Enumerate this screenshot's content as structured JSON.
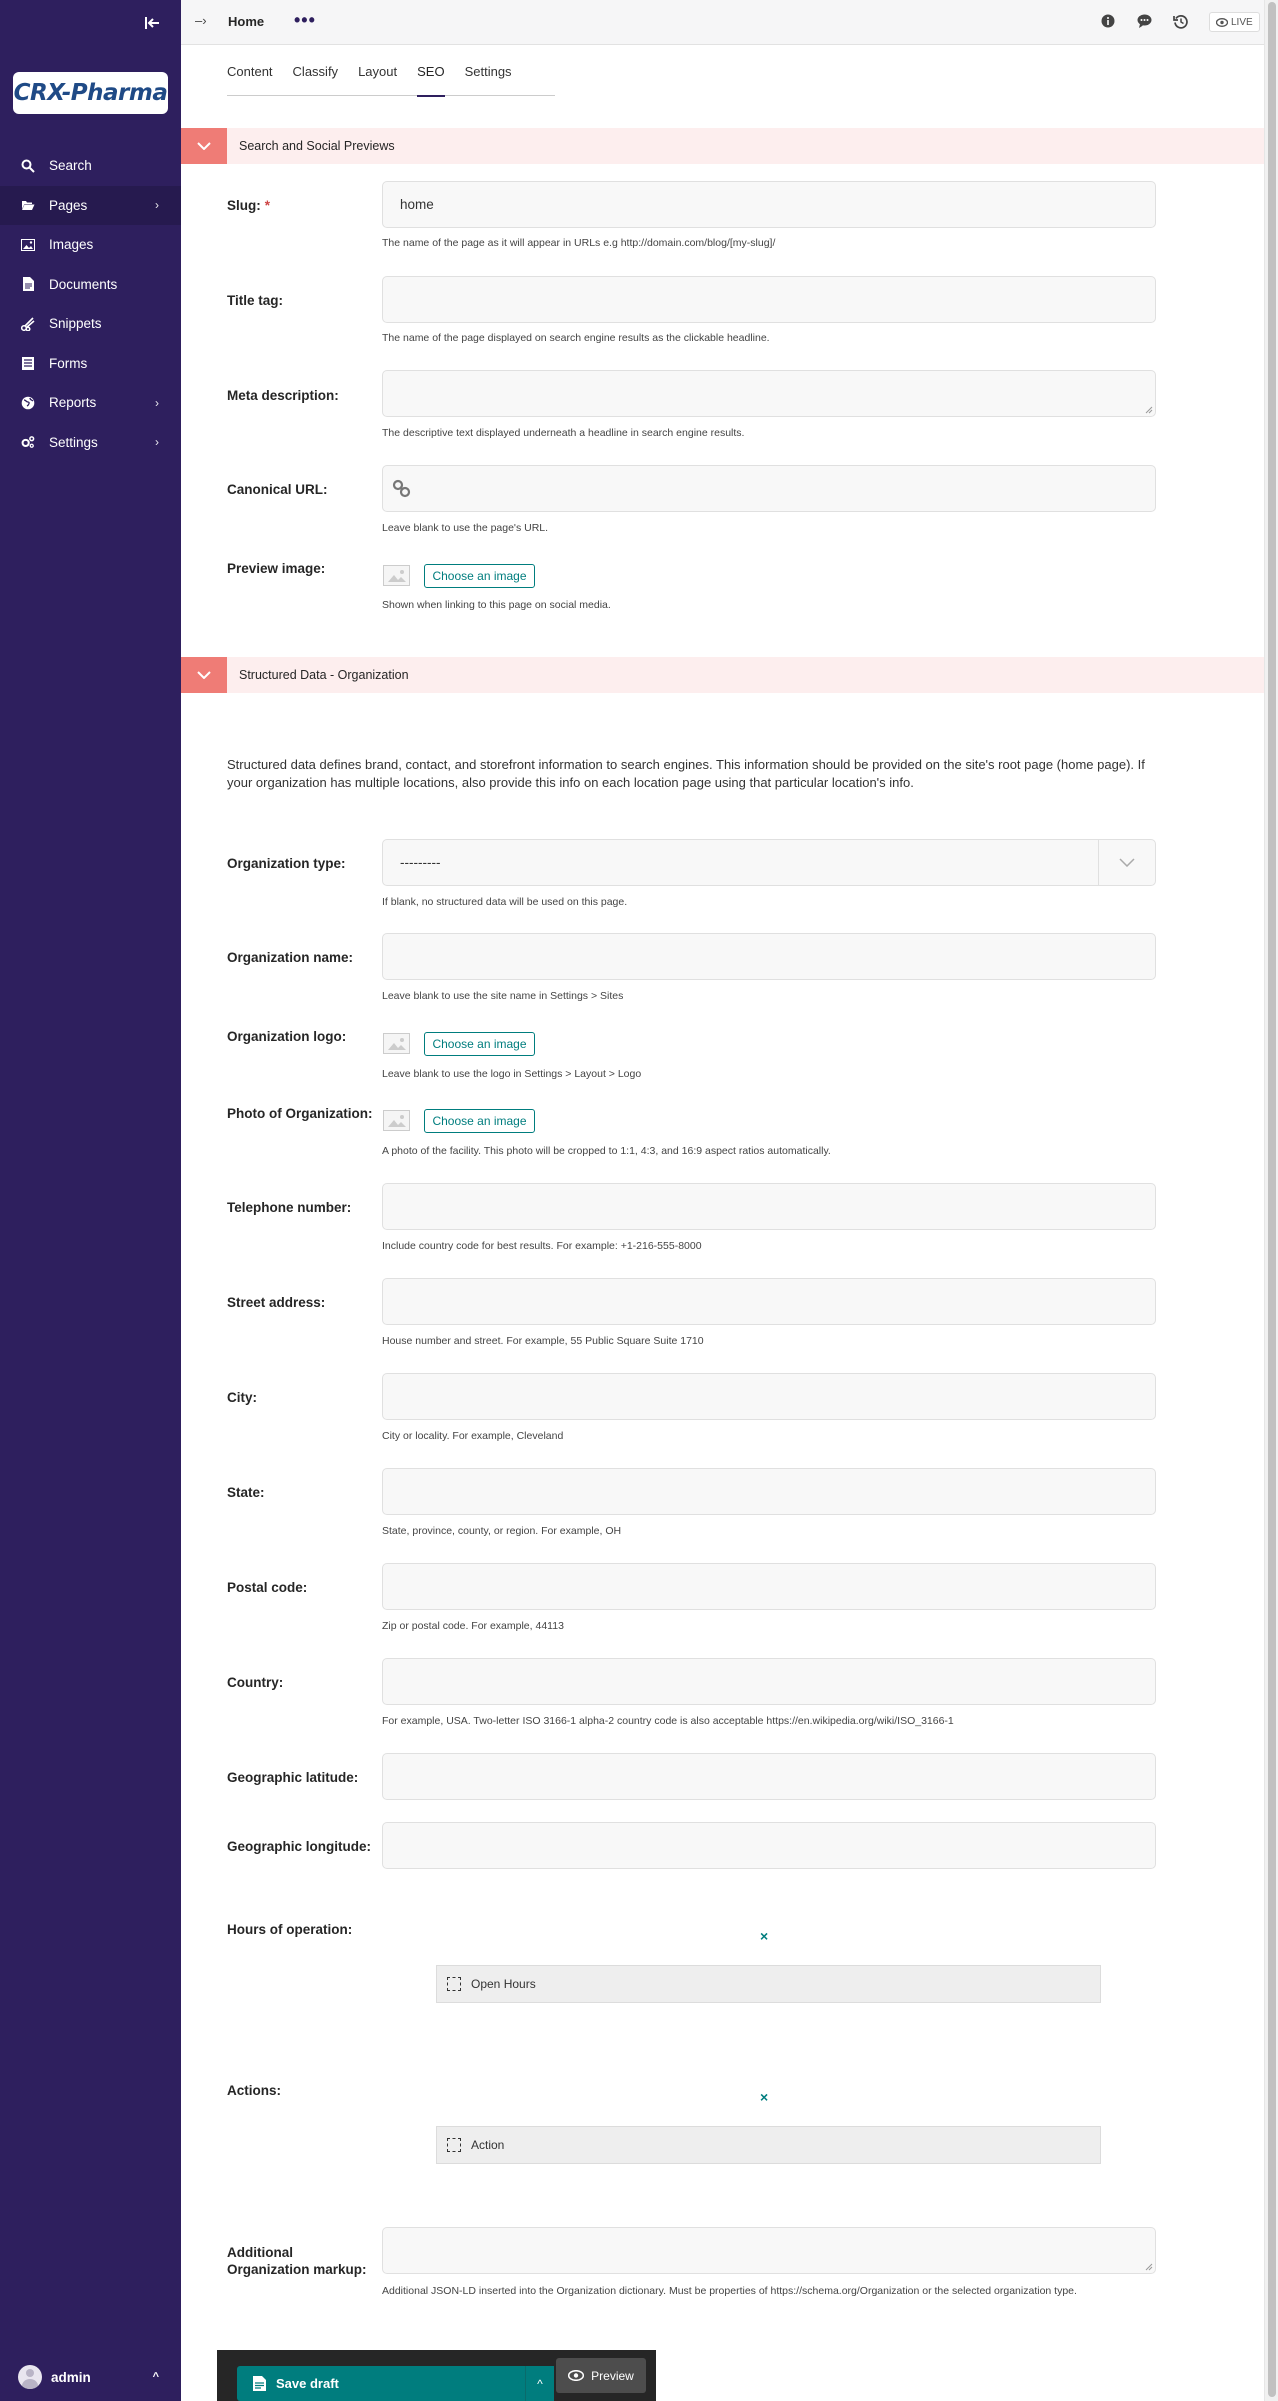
{
  "sidebar": {
    "logo_text": "CRX-Pharma",
    "nav": [
      {
        "label": "Search",
        "icon": "search-icon"
      },
      {
        "label": "Pages",
        "icon": "folder-open-icon",
        "has_children": true,
        "active": true
      },
      {
        "label": "Images",
        "icon": "image-icon"
      },
      {
        "label": "Documents",
        "icon": "document-icon"
      },
      {
        "label": "Snippets",
        "icon": "snippets-icon"
      },
      {
        "label": "Forms",
        "icon": "form-icon"
      },
      {
        "label": "Reports",
        "icon": "globe-icon",
        "has_children": true
      },
      {
        "label": "Settings",
        "icon": "cogs-icon",
        "has_children": true
      }
    ],
    "user": {
      "name": "admin"
    }
  },
  "header": {
    "breadcrumb_arrow": "–›",
    "title": "Home",
    "more_dots": "•••",
    "live_label": "LIVE"
  },
  "tabs": [
    {
      "label": "Content"
    },
    {
      "label": "Classify"
    },
    {
      "label": "Layout"
    },
    {
      "label": "SEO",
      "active": true
    },
    {
      "label": "Settings"
    }
  ],
  "sections": {
    "search": {
      "title": "Search and Social Previews"
    },
    "structured": {
      "title": "Structured Data - Organization"
    }
  },
  "fields": {
    "slug": {
      "label": "Slug:",
      "required_mark": "*",
      "value": "home",
      "help": "The name of the page as it will appear in URLs e.g http://domain.com/blog/[my-slug]/"
    },
    "title_tag": {
      "label": "Title tag:",
      "value": "",
      "help": "The name of the page displayed on search engine results as the clickable headline."
    },
    "meta_description": {
      "label": "Meta description:",
      "value": "",
      "help": "The descriptive text displayed underneath a headline in search engine results."
    },
    "canonical_url": {
      "label": "Canonical URL:",
      "value": "",
      "help": "Leave blank to use the page's URL."
    },
    "preview_image": {
      "label": "Preview image:",
      "button": "Choose an image",
      "help": "Shown when linking to this page on social media."
    },
    "intro_text": "Structured data defines brand, contact, and storefront information to search engines. This information should be provided on the site's root page (home page). If your organization has multiple locations, also provide this info on each location page using that particular location's info.",
    "org_type": {
      "label": "Organization type:",
      "value": "---------",
      "help": "If blank, no structured data will be used on this page."
    },
    "org_name": {
      "label": "Organization name:",
      "value": "",
      "help": "Leave blank to use the site name in Settings > Sites"
    },
    "org_logo": {
      "label": "Organization logo:",
      "button": "Choose an image",
      "help": "Leave blank to use the logo in Settings > Layout > Logo"
    },
    "org_photo": {
      "label": "Photo of Organization:",
      "button": "Choose an image",
      "help": "A photo of the facility. This photo will be cropped to 1:1, 4:3, and 16:9 aspect ratios automatically."
    },
    "telephone": {
      "label": "Telephone number:",
      "value": "",
      "help": "Include country code for best results. For example: +1-216-555-8000"
    },
    "street": {
      "label": "Street address:",
      "value": "",
      "help": "House number and street. For example, 55 Public Square Suite 1710"
    },
    "city": {
      "label": "City:",
      "value": "",
      "help": "City or locality. For example, Cleveland"
    },
    "state": {
      "label": "State:",
      "value": "",
      "help": "State, province, county, or region. For example, OH"
    },
    "postal": {
      "label": "Postal code:",
      "value": "",
      "help": "Zip or postal code. For example, 44113"
    },
    "country": {
      "label": "Country:",
      "value": "",
      "help": "For example, USA. Two-letter ISO 3166-1 alpha-2 country code is also acceptable https://en.wikipedia.org/wiki/ISO_3166-1"
    },
    "latitude": {
      "label": "Geographic latitude:",
      "value": ""
    },
    "longitude": {
      "label": "Geographic longitude:",
      "value": ""
    },
    "hours": {
      "label": "Hours of operation:",
      "block_label": "Open Hours",
      "remove_glyph": "×"
    },
    "actions": {
      "label": "Actions:",
      "block_label": "Action",
      "remove_glyph": "×"
    },
    "additional_markup": {
      "label": "Additional Organization markup:",
      "value": "",
      "help": "Additional JSON-LD inserted into the Organization dictionary. Must be properties of https://schema.org/Organization or the selected organization type."
    }
  },
  "footer": {
    "save_label": "Save draft",
    "preview_label": "Preview"
  },
  "colors": {
    "sidebar_bg": "#2e1f5e",
    "accent_teal": "#007d7e",
    "section_toggle": "#ef7c76",
    "section_bg": "#fdeeee"
  }
}
